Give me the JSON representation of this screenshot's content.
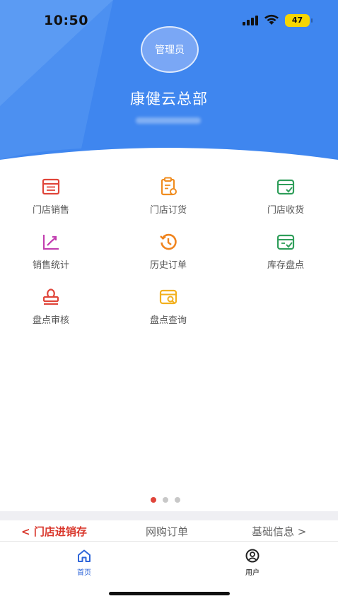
{
  "status_bar": {
    "time": "10:50",
    "battery": "47"
  },
  "profile": {
    "avatar_text": "管理员",
    "org_name": "康健云总部"
  },
  "functions": [
    {
      "label": "门店销售",
      "icon": "sales-register-icon",
      "color": "#e0453a"
    },
    {
      "label": "门店订货",
      "icon": "order-clipboard-icon",
      "color": "#f08c1e"
    },
    {
      "label": "门店收货",
      "icon": "receive-box-icon",
      "color": "#2f9e5a"
    },
    {
      "label": "销售统计",
      "icon": "chart-trend-icon",
      "color": "#c23fb0"
    },
    {
      "label": "历史订单",
      "icon": "history-clock-icon",
      "color": "#f0841e"
    },
    {
      "label": "库存盘点",
      "icon": "inventory-check-icon",
      "color": "#2f9e5a"
    },
    {
      "label": "盘点审核",
      "icon": "approval-stamp-icon",
      "color": "#e0453a"
    },
    {
      "label": "盘点查询",
      "icon": "search-card-icon",
      "color": "#f2b01e"
    }
  ],
  "pagination": {
    "pages": 3,
    "current": 1
  },
  "module_tabs": {
    "active": "门店进销存",
    "middle": "网购订单",
    "right": "基础信息"
  },
  "tabbar": {
    "home": {
      "label": "首页",
      "color": "#2f66d9"
    },
    "user": {
      "label": "用户",
      "color": "#222222"
    }
  },
  "colors": {
    "header_blue": "#3f86ef",
    "accent_red": "#d9372c"
  }
}
